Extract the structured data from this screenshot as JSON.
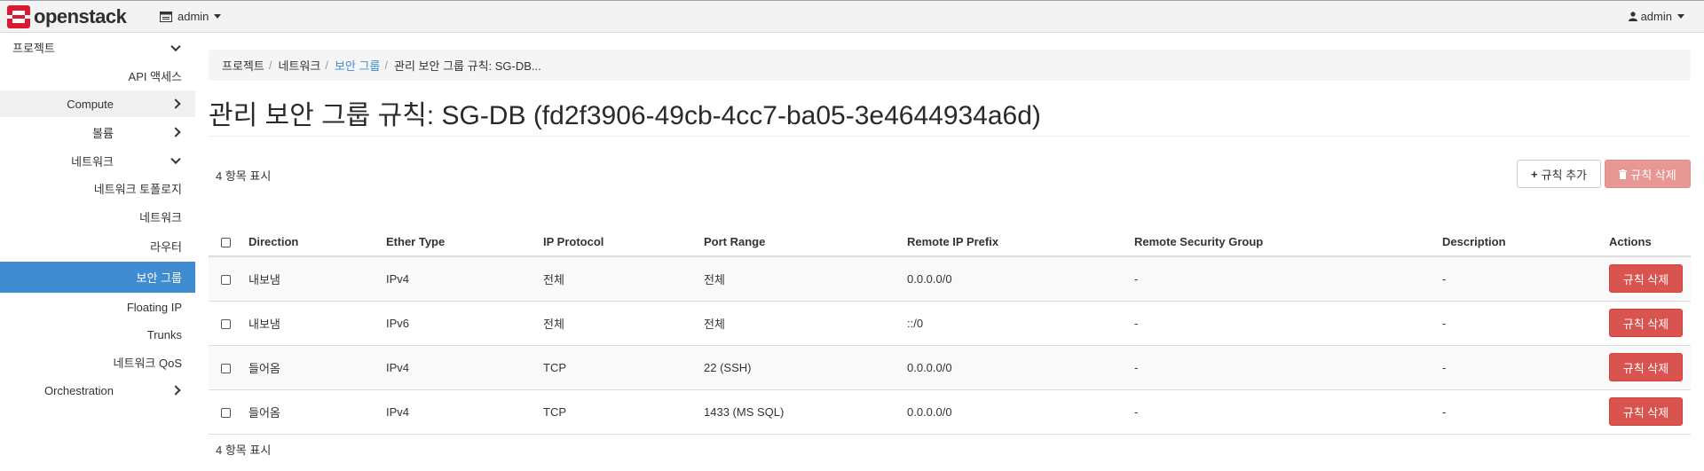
{
  "brand": {
    "name": "openstack",
    "accent": "#da1a32"
  },
  "header": {
    "project": "admin",
    "user": "admin"
  },
  "sidebar": {
    "items": [
      {
        "label": "프로젝트",
        "type": "section",
        "chevron": "down"
      },
      {
        "label": "API 액세스",
        "type": "link"
      },
      {
        "label": "Compute",
        "type": "group",
        "chevron": "right"
      },
      {
        "label": "볼륨",
        "type": "group",
        "chevron": "right"
      },
      {
        "label": "네트워크",
        "type": "group",
        "chevron": "down"
      },
      {
        "label": "네트워크 토폴로지",
        "type": "link"
      },
      {
        "label": "네트워크",
        "type": "link"
      },
      {
        "label": "라우터",
        "type": "link"
      },
      {
        "label": "보안 그룹",
        "type": "link",
        "active": true
      },
      {
        "label": "Floating IP",
        "type": "link"
      },
      {
        "label": "Trunks",
        "type": "link"
      },
      {
        "label": "네트워크 QoS",
        "type": "link"
      },
      {
        "label": "Orchestration",
        "type": "group",
        "chevron": "right"
      }
    ]
  },
  "breadcrumb": [
    "프로젝트",
    "네트워크",
    "보안 그룹",
    "관리 보안 그룹 규칙: SG-DB..."
  ],
  "page": {
    "title": "관리 보안 그룹 규칙: SG-DB (fd2f3906-49cb-4cc7-ba05-3e4644934a6d)",
    "add_button": "규칙 추가",
    "delete_button": "규칙 삭제",
    "count_top": "4 항목 표시",
    "count_bottom": "4 항목 표시"
  },
  "table": {
    "columns": [
      "Direction",
      "Ether Type",
      "IP Protocol",
      "Port Range",
      "Remote IP Prefix",
      "Remote Security Group",
      "Description",
      "Actions"
    ],
    "rows": [
      {
        "direction": "내보냄",
        "ether_type": "IPv4",
        "protocol": "전체",
        "port_range": "전체",
        "remote_ip": "0.0.0.0/0",
        "remote_group": "-",
        "description": "-",
        "action": "규칙 삭제"
      },
      {
        "direction": "내보냄",
        "ether_type": "IPv6",
        "protocol": "전체",
        "port_range": "전체",
        "remote_ip": "::/0",
        "remote_group": "-",
        "description": "-",
        "action": "규칙 삭제"
      },
      {
        "direction": "들어옴",
        "ether_type": "IPv4",
        "protocol": "TCP",
        "port_range": "22 (SSH)",
        "remote_ip": "0.0.0.0/0",
        "remote_group": "-",
        "description": "-",
        "action": "규칙 삭제"
      },
      {
        "direction": "들어옴",
        "ether_type": "IPv4",
        "protocol": "TCP",
        "port_range": "1433 (MS SQL)",
        "remote_ip": "0.0.0.0/0",
        "remote_group": "-",
        "description": "-",
        "action": "규칙 삭제"
      }
    ]
  },
  "colors": {
    "active_nav": "#3f8dd0",
    "danger": "#d9534f",
    "danger_disabled": "#e89894",
    "link": "#3f8dd0"
  }
}
